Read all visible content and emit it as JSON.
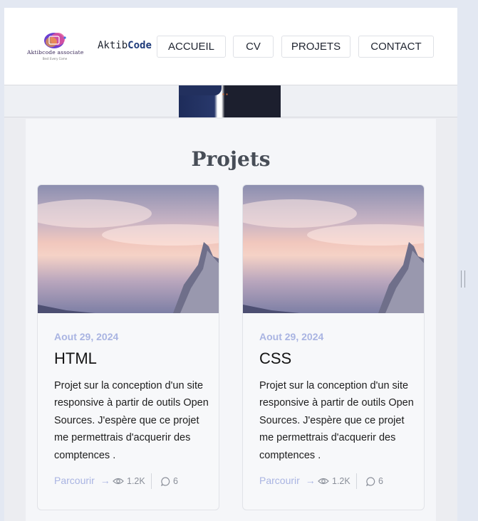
{
  "header": {
    "logo_name": "Aktibcode associate",
    "logo_tagline": "Best Every Come",
    "brand_prefix": "Aktib",
    "brand_suffix": "Code",
    "nav": [
      "ACCUEIL",
      "CV",
      "PROJETS",
      "CONTACT"
    ]
  },
  "section": {
    "title": "Projets"
  },
  "cards": [
    {
      "date": "Aout 29, 2024",
      "title": "HTML",
      "desc": "Projet sur la conception d'un site responsive à partir de outils Open Sources. J'espère que ce projet me permettrais d'acquerir des comptences .",
      "link": "Parcourir",
      "views": "1.2K",
      "comments": "6"
    },
    {
      "date": "Aout 29, 2024",
      "title": "CSS",
      "desc": "Projet sur la conception d'un site responsive à partir de outils Open Sources. J'espère que ce projet me permettrais d'acquerir des comptences .",
      "link": "Parcourir",
      "views": "1.2K",
      "comments": "6"
    }
  ],
  "icons": {
    "arrow": "arrow-right-icon",
    "views": "eye-icon",
    "comments": "comment-bubble-icon"
  },
  "colors": {
    "accent": "#a9b4e2",
    "brand_code": "#1d3a7a",
    "title": "#474d57"
  }
}
